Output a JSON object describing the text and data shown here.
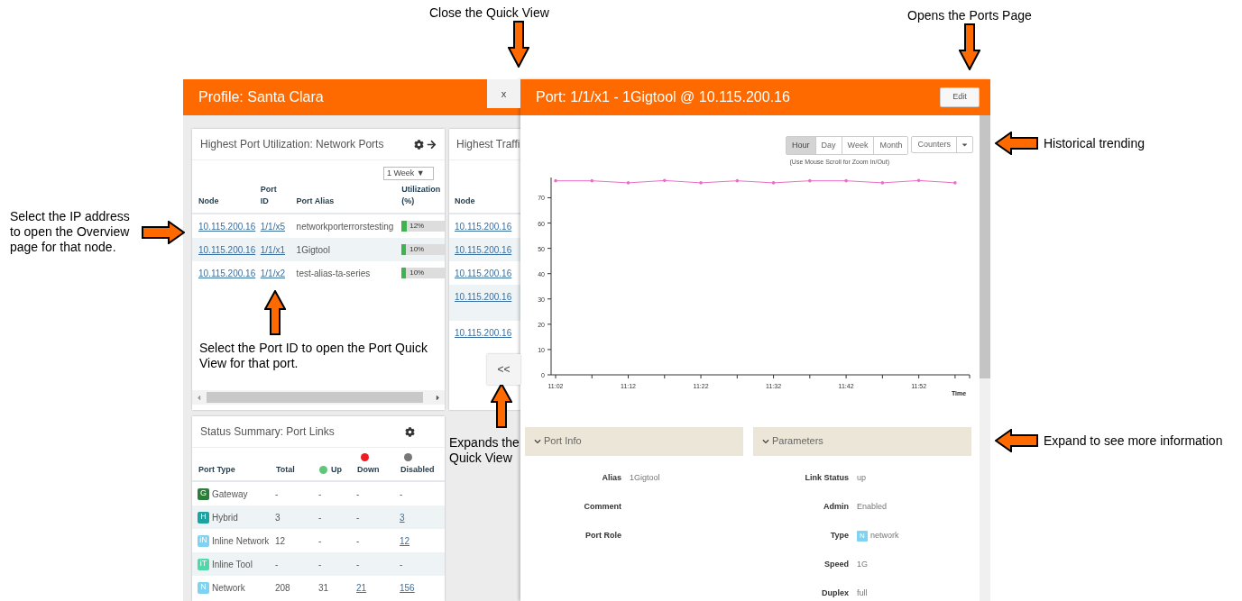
{
  "callouts": [
    {
      "text": "Close the Quick View",
      "kind": "down"
    },
    {
      "text": "Opens the Ports Page",
      "kind": "down"
    },
    {
      "text": "Historical trending",
      "kind": "left"
    },
    {
      "text": "Expand to see more information",
      "kind": "left"
    },
    {
      "text": "Select the IP address to open the Overview page for that node.",
      "kind": "right"
    },
    {
      "text": "Select the Port ID to open the Port Quick View for that port.",
      "kind": "up"
    },
    {
      "text": "Expands the Quick View",
      "kind": "up"
    }
  ],
  "profile": {
    "title": "Profile: Santa Clara",
    "close_button": "x",
    "expand_button": "<<"
  },
  "utilization_card": {
    "title": "Highest Port Utilization: Network Ports",
    "period": "1 Week ▼",
    "columns": [
      "Node",
      "Port ID",
      "Port Alias",
      "Utilization (%)"
    ],
    "rows": [
      {
        "node": "10.115.200.16",
        "port_id": "1/1/x5",
        "alias": "networkporterrorstesting",
        "utilization": "12%",
        "level": 0.12
      },
      {
        "node": "10.115.200.16",
        "port_id": "1/1/x1",
        "alias": "1Gigtool",
        "utilization": "10%",
        "level": 0.1
      },
      {
        "node": "10.115.200.16",
        "port_id": "1/1/x2",
        "alias": "test-alias-ta-series",
        "utilization": "10%",
        "level": 0.1
      }
    ]
  },
  "traffic_card": {
    "title": "Highest Traffi",
    "columns": [
      "Node"
    ],
    "rows": [
      {
        "node": "10.115.200.16"
      },
      {
        "node": "10.115.200.16"
      },
      {
        "node": "10.115.200.16"
      },
      {
        "node": "10.115.200.16"
      },
      {
        "node": "10.115.200.16"
      }
    ]
  },
  "status_card": {
    "title": "Status Summary: Port Links",
    "columns": [
      {
        "label": "Port Type"
      },
      {
        "label": "Total"
      },
      {
        "label": "Up",
        "color": "#5ec77a"
      },
      {
        "label": "Down",
        "color": "#ee1c25"
      },
      {
        "label": "Disabled",
        "color": "#777777"
      }
    ],
    "rows": [
      {
        "badge": "G",
        "color": "#2e7d3a",
        "type": "Gateway",
        "total": "-",
        "up": "-",
        "down": "-",
        "disabled": "-"
      },
      {
        "badge": "H",
        "color": "#1aa3a0",
        "type": "Hybrid",
        "total": "3",
        "up": "-",
        "down": "-",
        "disabled": "3"
      },
      {
        "badge": "iN",
        "color": "#7fd2f0",
        "type": "Inline Network",
        "total": "12",
        "up": "-",
        "down": "-",
        "disabled": "12"
      },
      {
        "badge": "iT",
        "color": "#52d8a8",
        "type": "Inline Tool",
        "total": "-",
        "up": "-",
        "down": "-",
        "disabled": "-"
      },
      {
        "badge": "N",
        "color": "#7fd2f0",
        "type": "Network",
        "total": "208",
        "up": "31",
        "down": "21",
        "disabled": "156"
      }
    ]
  },
  "quick_view": {
    "title": "Port: 1/1/x1 - 1Gigtool @ 10.115.200.16",
    "edit_button": "Edit",
    "ranges": [
      {
        "label": "Hour",
        "selected": true
      },
      {
        "label": "Day",
        "selected": false
      },
      {
        "label": "Week",
        "selected": false
      },
      {
        "label": "Month",
        "selected": false
      }
    ],
    "counters": "Counters",
    "zoom_hint": "(Use Mouse Scroll for Zoom In/Out)",
    "chart_data": {
      "type": "line",
      "xlabel": "Time",
      "categories": [
        "11:02",
        null,
        "11:12",
        null,
        "11:22",
        null,
        "11:32",
        null,
        "11:42",
        null,
        "11:52",
        null
      ],
      "ylim": [
        0,
        78
      ],
      "yticks": [
        0,
        10,
        20,
        30,
        40,
        50,
        60,
        70
      ],
      "series": [
        {
          "color": "#e86fc6",
          "values": [
            76.7,
            76.7,
            75.9,
            76.8,
            75.9,
            76.7,
            75.9,
            76.7,
            76.7,
            75.9,
            76.8,
            75.9
          ]
        }
      ]
    },
    "port_info": {
      "title": "Port Info",
      "expanded": true,
      "rows": [
        {
          "label": "Alias",
          "value": "1Gigtool"
        },
        {
          "label": "Comment"
        },
        {
          "label": "Port Role"
        }
      ]
    },
    "parameters": {
      "title": "Parameters",
      "expanded": true,
      "rows": [
        {
          "label": "Link Status",
          "value": "up"
        },
        {
          "label": "Admin",
          "value": "Enabled"
        },
        {
          "label": "Type",
          "badge": "N",
          "color": "#7fd2f0",
          "value": "network"
        },
        {
          "label": "Speed",
          "value": "1G"
        },
        {
          "label": "Duplex",
          "value": "full"
        }
      ]
    }
  }
}
